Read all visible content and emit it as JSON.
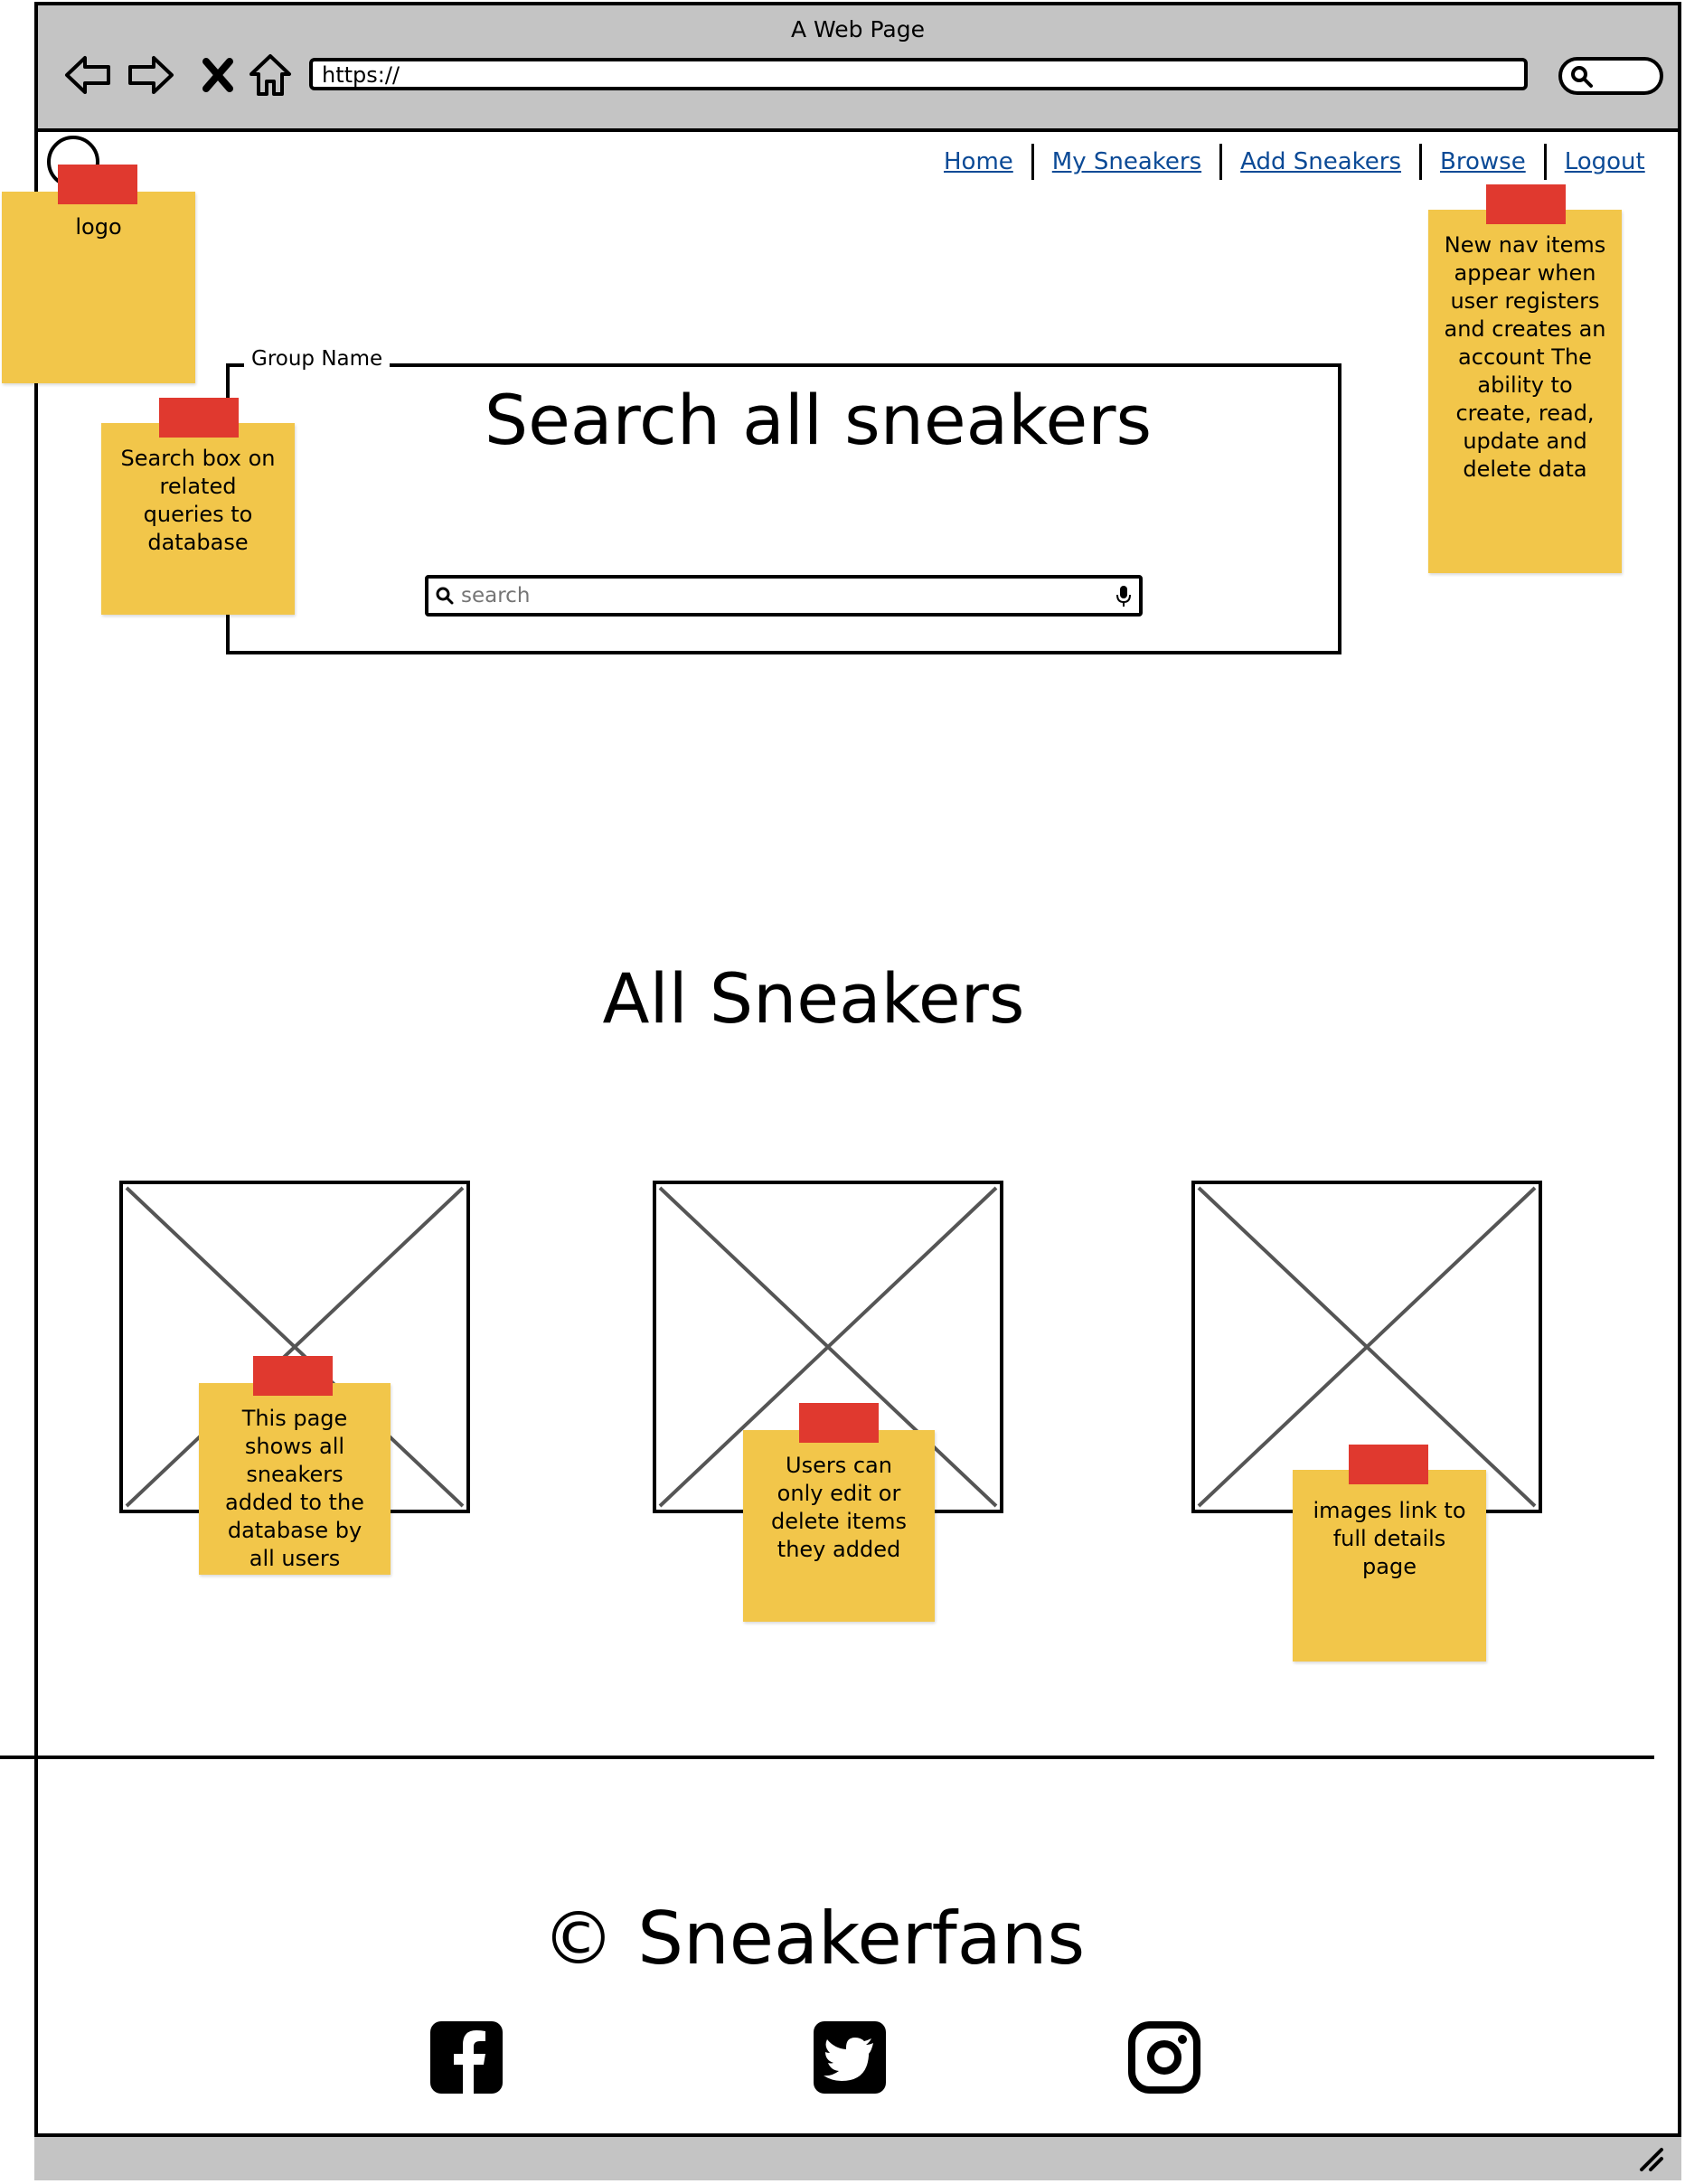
{
  "window": {
    "title": "A Web Page",
    "url": "https://"
  },
  "nav": {
    "items": [
      {
        "label": "Home"
      },
      {
        "label": "My Sneakers"
      },
      {
        "label": "Add Sneakers"
      },
      {
        "label": "Browse"
      },
      {
        "label": "Logout"
      }
    ]
  },
  "group": {
    "label": "Group Name",
    "heading": "Search all sneakers",
    "search_placeholder": "search"
  },
  "main": {
    "heading": "All Sneakers"
  },
  "footer": {
    "copyright": "© Sneakerfans"
  },
  "social": [
    "facebook-icon",
    "twitter-icon",
    "instagram-icon"
  ],
  "notes": {
    "logo": "logo",
    "search": "Search box on related queries to database",
    "nav": "New nav items appear when user registers and creates an account The ability to create, read, update and delete data",
    "image1": "This page shows all sneakers added to the database by all users",
    "image2": "Users can only edit or delete items they added",
    "image3": "images link to full details page"
  },
  "colors": {
    "chrome": "#c4c4c4",
    "link": "#0b4a96",
    "note": "#f2c64a",
    "tape": "#e0392f"
  }
}
